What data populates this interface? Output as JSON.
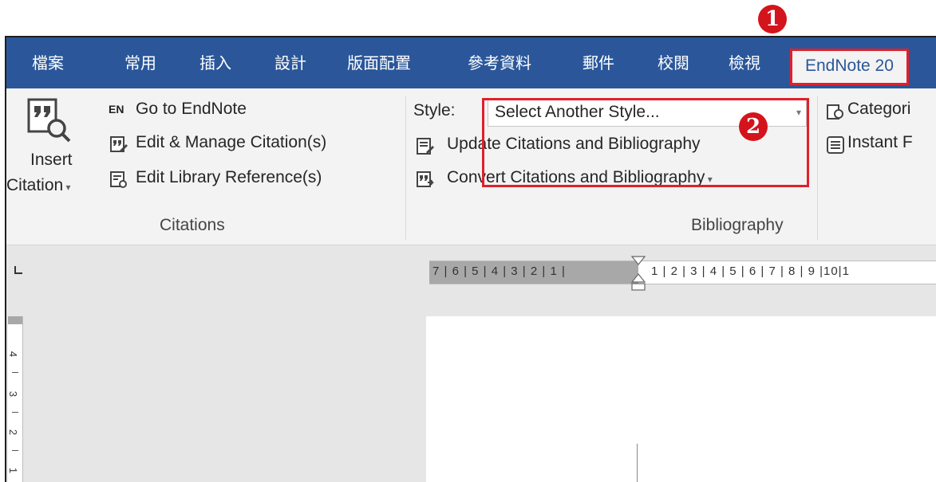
{
  "tabs": [
    "檔案",
    "常用",
    "插入",
    "設計",
    "版面配置",
    "參考資料",
    "郵件",
    "校閱",
    "檢視",
    "EndNote 20"
  ],
  "callouts": {
    "one": "1",
    "two": "2"
  },
  "citations_group": {
    "insert_label_line1": "Insert",
    "insert_label_line2": "Citation",
    "go_to_endnote": "Go to EndNote",
    "edit_manage": "Edit & Manage Citation(s)",
    "edit_library": "Edit Library Reference(s)",
    "group_label": "Citations",
    "en_icon_text": "EN"
  },
  "bibliography_group": {
    "style_label": "Style:",
    "style_value": "Select Another Style...",
    "update": "Update Citations and Bibliography",
    "convert": "Convert Citations and Bibliography",
    "group_label": "Bibliography"
  },
  "extra": {
    "categories": "Categori",
    "instant": "Instant F"
  },
  "ruler": {
    "left_numbers": "7 | 6 | 5 | 4 | 3 | 2 | 1 |",
    "right_numbers": "1 | 2 | 3 | 4 | 5 | 6 | 7 | 8 | 9 |10|1",
    "vertical": [
      "4",
      "3",
      "2",
      "1"
    ]
  },
  "colors": {
    "tabbar": "#2b579a",
    "highlight": "#e0202c",
    "ribbon": "#f3f3f3"
  }
}
